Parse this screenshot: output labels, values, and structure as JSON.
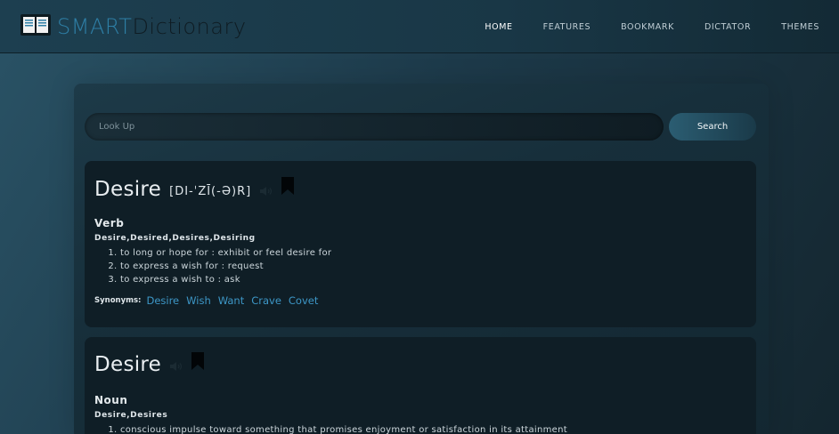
{
  "brand": {
    "part1": "SMART",
    "part2": "Dictionary",
    "logo_icon": "open-book-icon"
  },
  "nav": [
    {
      "label": "HOME",
      "active": true
    },
    {
      "label": "FEATURES"
    },
    {
      "label": "BOOKMARK"
    },
    {
      "label": "DICTATOR"
    },
    {
      "label": "THEMES"
    }
  ],
  "search": {
    "placeholder": "Look Up",
    "value": "",
    "button_label": "Search"
  },
  "entries": [
    {
      "word": "Desire",
      "phonetic": "[DI-ˈZĪ(-Ə)R]",
      "pos": "Verb",
      "forms": "Desire,Desired,Desires,Desiring",
      "definitions": [
        "to long or hope for : exhibit or feel desire for",
        "to express a wish for : request",
        "to express a wish to : ask"
      ],
      "synonyms_label": "Synonyms:",
      "synonyms": [
        "Desire",
        "Wish",
        "Want",
        "Crave",
        "Covet"
      ]
    },
    {
      "word": "Desire",
      "pos": "Noun",
      "forms": "Desire,Desires",
      "definitions": [
        "conscious impulse toward something that promises enjoyment or satisfaction in its attainment"
      ]
    }
  ],
  "colors": {
    "accent": "#3d97c7",
    "brand_blue": "#2e7fa6",
    "card_bg": "#0f1e26"
  }
}
